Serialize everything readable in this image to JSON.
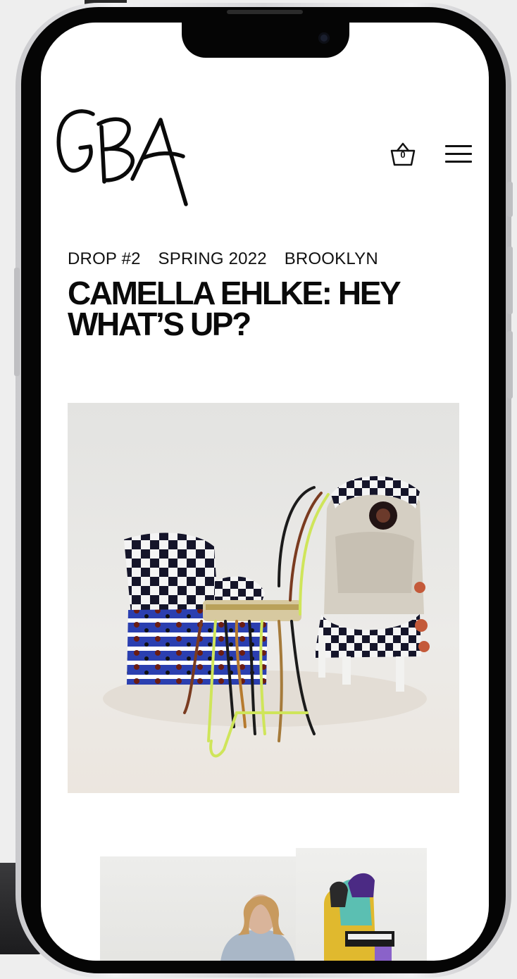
{
  "header": {
    "logo_text": "GBA",
    "cart_count": "0"
  },
  "article": {
    "drop": "DROP #2",
    "season": "SPRING 2022",
    "location": "BROOKLYN",
    "title": "CAMELLA EHLKE: HEY WHAT’S UP?"
  },
  "icons": {
    "cart": "basket-icon",
    "menu": "hamburger-menu-icon"
  },
  "colors": {
    "text": "#0a0a0a",
    "background": "#ffffff",
    "frame": "#050505"
  }
}
